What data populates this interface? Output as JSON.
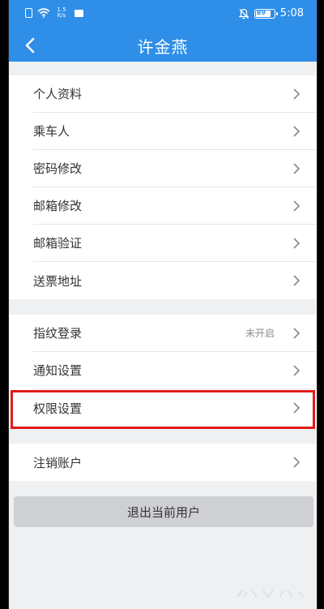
{
  "status_bar": {
    "net_speed": "1.5 K/s",
    "battery_level": "89",
    "time": "5:08"
  },
  "header": {
    "title": "许金燕"
  },
  "groups": [
    {
      "items": [
        {
          "label": "个人资料"
        },
        {
          "label": "乘车人"
        },
        {
          "label": "密码修改"
        },
        {
          "label": "邮箱修改"
        },
        {
          "label": "邮箱验证"
        },
        {
          "label": "送票地址"
        }
      ]
    },
    {
      "items": [
        {
          "label": "指纹登录",
          "value": "未开启"
        },
        {
          "label": "通知设置"
        },
        {
          "label": "权限设置",
          "highlighted": true
        }
      ]
    },
    {
      "items": [
        {
          "label": "注销账户"
        }
      ]
    }
  ],
  "logout_button": {
    "label": "退出当前用户"
  },
  "colors": {
    "header_blue": "#2f8ee8",
    "highlight_red": "#e21b1b",
    "page_bg": "#eef0f2",
    "button_gray": "#cfd0d3"
  },
  "icons": {
    "back": "chevron-left-icon",
    "row_arrow": "chevron-right-icon"
  }
}
